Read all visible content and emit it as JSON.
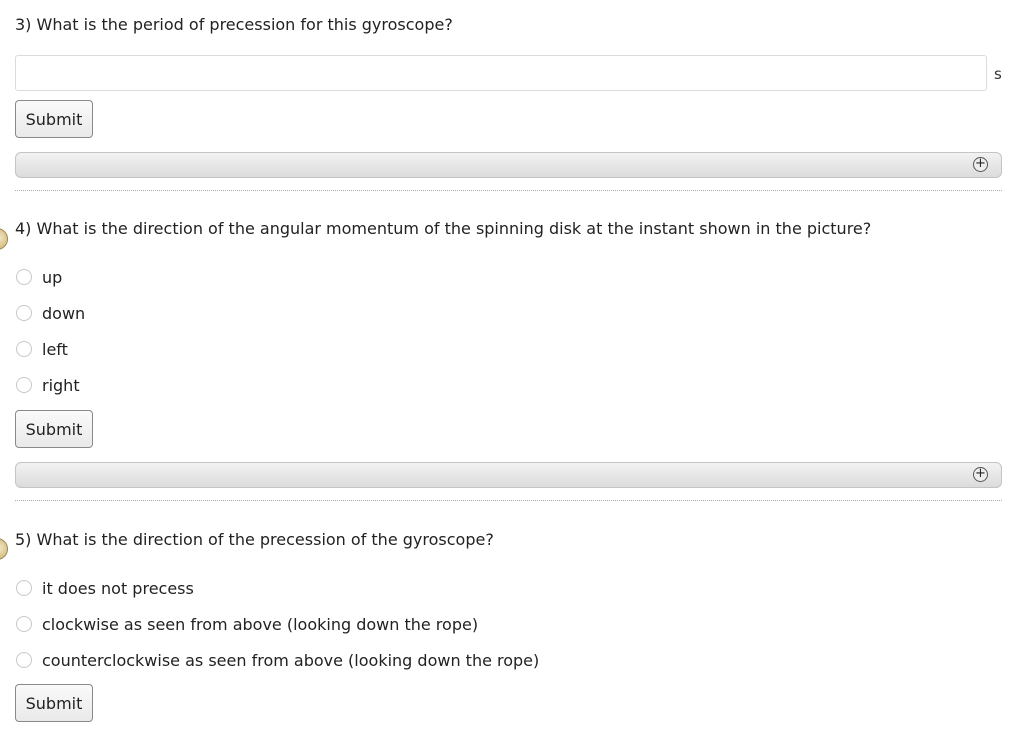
{
  "q3": {
    "prompt": "3) What is the period of precession for this gyroscope?",
    "answer_value": "",
    "unit": "s",
    "submit_label": "Submit",
    "hint_icon": "plus-circle-icon"
  },
  "q4": {
    "prompt": "4) What is the direction of the angular momentum of the spinning disk at the instant shown in the picture?",
    "options": [
      "up",
      "down",
      "left",
      "right"
    ],
    "submit_label": "Submit",
    "hint_icon": "plus-circle-icon",
    "status_icon": "medal-icon"
  },
  "q5": {
    "prompt": "5) What is the direction of the precession of the gyroscope?",
    "options": [
      "it does not precess",
      "clockwise as seen from above (looking down the rope)",
      "counterclockwise as seen from above (looking down the rope)"
    ],
    "submit_label": "Submit",
    "status_icon": "medal-icon"
  }
}
